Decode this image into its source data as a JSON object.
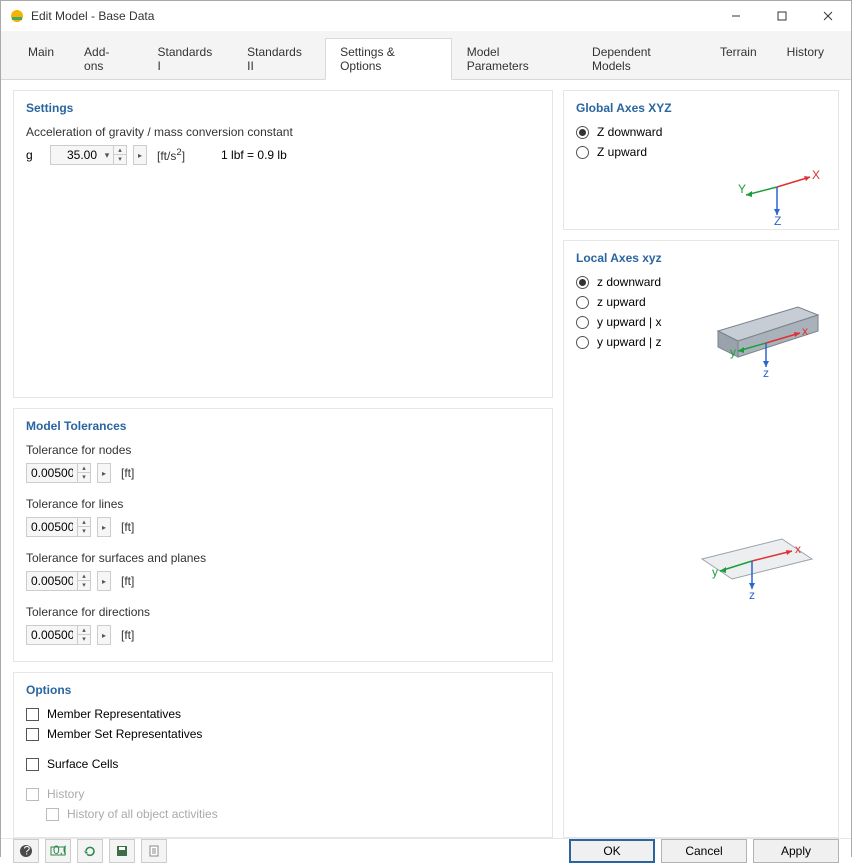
{
  "window": {
    "title": "Edit Model - Base Data"
  },
  "tabs": [
    "Main",
    "Add-ons",
    "Standards I",
    "Standards II",
    "Settings & Options",
    "Model Parameters",
    "Dependent Models",
    "Terrain",
    "History"
  ],
  "activeTab": "Settings & Options",
  "settings": {
    "title": "Settings",
    "accel_label": "Acceleration of gravity / mass conversion constant",
    "g": "g",
    "g_value": "35.00",
    "g_unit": "[ft/s²]",
    "conv": "1 lbf = 0.9 lb"
  },
  "tolerances": {
    "title": "Model Tolerances",
    "items": [
      {
        "label": "Tolerance for nodes",
        "value": "0.00500",
        "unit": "[ft]"
      },
      {
        "label": "Tolerance for lines",
        "value": "0.00500",
        "unit": "[ft]"
      },
      {
        "label": "Tolerance for surfaces and planes",
        "value": "0.00500",
        "unit": "[ft]"
      },
      {
        "label": "Tolerance for directions",
        "value": "0.00500",
        "unit": "[ft]"
      }
    ]
  },
  "options": {
    "title": "Options",
    "items": [
      {
        "label": "Member Representatives",
        "checked": false,
        "disabled": false
      },
      {
        "label": "Member Set Representatives",
        "checked": false,
        "disabled": false
      },
      {
        "label": "Surface Cells",
        "checked": false,
        "disabled": false,
        "gap": true
      },
      {
        "label": "History",
        "checked": false,
        "disabled": true,
        "gap": true
      },
      {
        "label": "History of all object activities",
        "checked": false,
        "disabled": true,
        "indent": true
      }
    ]
  },
  "globalAxes": {
    "title": "Global Axes XYZ",
    "options": [
      {
        "label": "Z downward",
        "checked": true
      },
      {
        "label": "Z upward",
        "checked": false
      }
    ]
  },
  "localAxes": {
    "title": "Local Axes xyz",
    "options": [
      {
        "label": "z downward",
        "checked": true
      },
      {
        "label": "z upward",
        "checked": false
      },
      {
        "label": "y upward | x",
        "checked": false
      },
      {
        "label": "y upward | z",
        "checked": false
      }
    ]
  },
  "footer": {
    "ok": "OK",
    "cancel": "Cancel",
    "apply": "Apply"
  }
}
